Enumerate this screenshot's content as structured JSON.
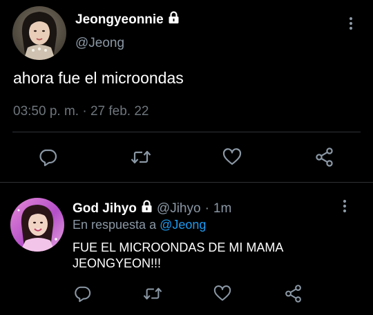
{
  "main_tweet": {
    "display_name": "Jeongyeonnie",
    "handle": "@Jeong",
    "text": "ahora fue el microondas",
    "timestamp": "03:50 p. m. · 27 feb. 22",
    "actions": [
      "reply-icon",
      "retweet-icon",
      "like-icon",
      "share-icon"
    ]
  },
  "reply_tweet": {
    "display_name": "God Jihyo",
    "handle": "@Jihyo",
    "separator": "·",
    "time": "1m",
    "reply_prefix": "En respuesta a",
    "reply_mention": "@Jeong",
    "text": "FUE EL MICROONDAS DE MI MAMA JEONGYEON!!!",
    "actions": [
      "reply-icon",
      "retweet-icon",
      "like-icon",
      "share-icon"
    ]
  },
  "colors": {
    "background": "#000000",
    "primary_text": "#ffffff",
    "secondary_text": "#8b98a5",
    "muted_text": "#6e767d",
    "mention": "#1d9bf0",
    "icon": "#8b98a5",
    "divider": "#2f3336"
  }
}
